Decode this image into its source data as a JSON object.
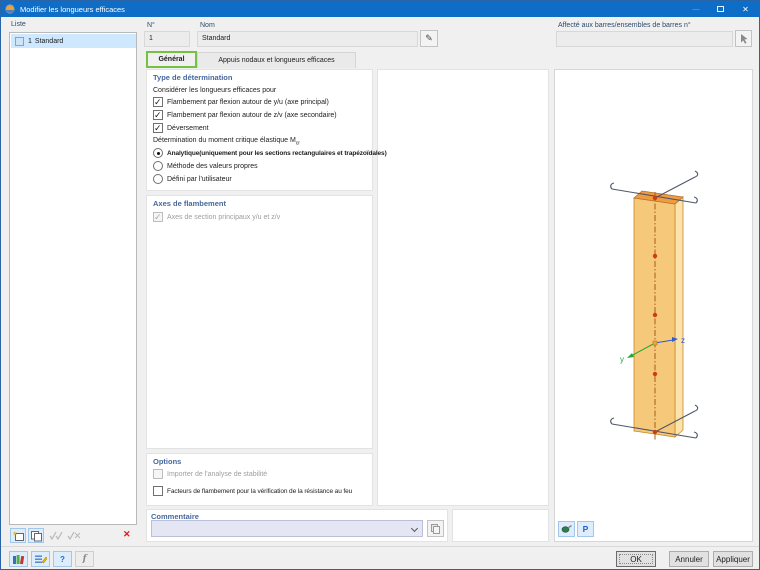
{
  "window": {
    "title": "Modifier les longueurs efficaces",
    "controls": {
      "minimize": "—",
      "close": "✕"
    }
  },
  "icons": {
    "edit_pencil": "✎",
    "delete_x": "✕",
    "function_f": "f",
    "help_mark": "?",
    "print_p": "P"
  },
  "list_panel": {
    "label": "Liste",
    "items": [
      {
        "number": "1",
        "name": "Standard"
      }
    ]
  },
  "fields": {
    "number_label": "N°",
    "number_value": "1",
    "name_label": "Nom",
    "name_value": "Standard",
    "assigned_label": "Affecté aux barres/ensembles de barres n°",
    "assigned_value": ""
  },
  "tabs": [
    {
      "label": "Général",
      "selected": true
    },
    {
      "label": "Appuis nodaux et longueurs efficaces",
      "selected": false
    }
  ],
  "general": {
    "determination": {
      "heading": "Type de détermination",
      "consider_label": "Considérer les longueurs efficaces pour",
      "checkboxes": [
        {
          "label": "Flambement par flexion autour de y/u (axe principal)",
          "checked": true
        },
        {
          "label": "Flambement par flexion autour de z/v (axe secondaire)",
          "checked": true
        },
        {
          "label": "Déversement",
          "checked": true
        }
      ],
      "mcr_label": "Détermination du moment critique élastique M",
      "mcr_subscript": "cr",
      "radios": [
        {
          "label": "Analytique(uniquement pour les sections rectangulaires et trapézoïdales)",
          "selected": true
        },
        {
          "label": "Méthode des valeurs propres",
          "selected": false
        },
        {
          "label": "Défini par l'utilisateur",
          "selected": false
        }
      ]
    },
    "buckling_axes": {
      "heading": "Axes de flambement",
      "checkbox_label": "Axes de section principaux y/u et z/v",
      "checked": true,
      "disabled": true
    },
    "options": {
      "heading": "Options",
      "import_label": "Importer de l'analyse de stabilité",
      "fire_label": "Facteurs de flambement pour la vérification de la résistance au feu"
    },
    "comment": {
      "heading": "Commentaire",
      "value": ""
    }
  },
  "graphic": {
    "axis_y": "y",
    "axis_z": "z"
  },
  "footer": {
    "ok": "OK",
    "cancel": "Annuler",
    "apply": "Appliquer"
  },
  "colors": {
    "titlebar": "#0d6dc7",
    "tab_highlight": "#76c043",
    "heading_blue": "#46689c",
    "selection": "#cde8ff",
    "column_front": "#f6c97a",
    "column_side": "#fbe3ab",
    "column_top": "#ef9b42",
    "axis_y_green": "#1daa35",
    "axis_z_blue": "#2f5bd7",
    "delete_red": "#d91a1a"
  }
}
